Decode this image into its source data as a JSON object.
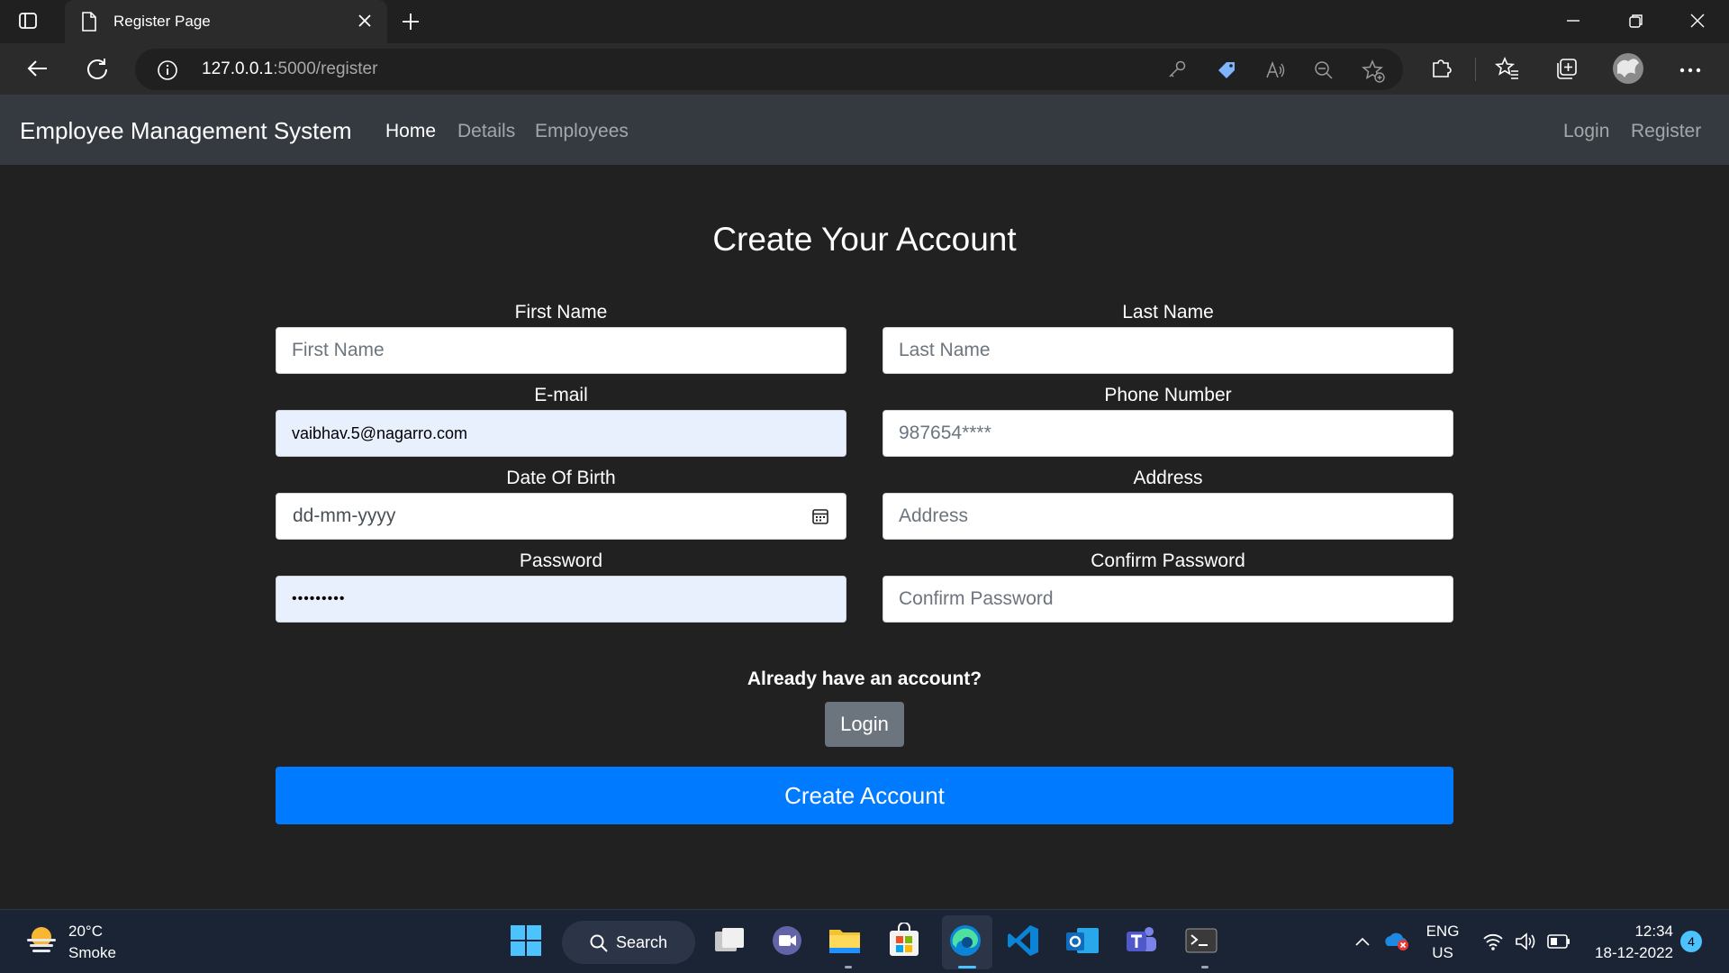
{
  "browser": {
    "tab_title": "Register Page",
    "url_host": "127.0.0.1",
    "url_path": ":5000/register"
  },
  "navbar": {
    "brand": "Employee Management System",
    "links": [
      "Home",
      "Details",
      "Employees"
    ],
    "active_link": "Home",
    "right_links": [
      "Login",
      "Register"
    ]
  },
  "form": {
    "heading": "Create Your Account",
    "first_name": {
      "label": "First Name",
      "placeholder": "First Name",
      "value": ""
    },
    "last_name": {
      "label": "Last Name",
      "placeholder": "Last Name",
      "value": ""
    },
    "email": {
      "label": "E-mail",
      "placeholder": "",
      "value": "vaibhav.5@nagarro.com"
    },
    "phone": {
      "label": "Phone Number",
      "placeholder": "",
      "value": "987654****"
    },
    "dob": {
      "label": "Date Of Birth",
      "placeholder": "dd-mm-yyyy"
    },
    "address": {
      "label": "Address",
      "placeholder": "Address",
      "value": ""
    },
    "password": {
      "label": "Password",
      "value": "•••••••••"
    },
    "confirm_password": {
      "label": "Confirm Password",
      "placeholder": "Confirm Password",
      "value": ""
    },
    "already_text": "Already have an account?",
    "login_button": "Login",
    "create_button": "Create Account"
  },
  "taskbar": {
    "weather_temp": "20°C",
    "weather_desc": "Smoke",
    "search_label": "Search",
    "lang_top": "ENG",
    "lang_bottom": "US",
    "time": "12:34",
    "date": "18-12-2022",
    "notification_count": "4"
  },
  "colors": {
    "navbar_bg": "#343a40",
    "page_bg": "#212121",
    "primary": "#007bff",
    "secondary": "#6c757d",
    "autofill_bg": "#e8f0fe"
  }
}
